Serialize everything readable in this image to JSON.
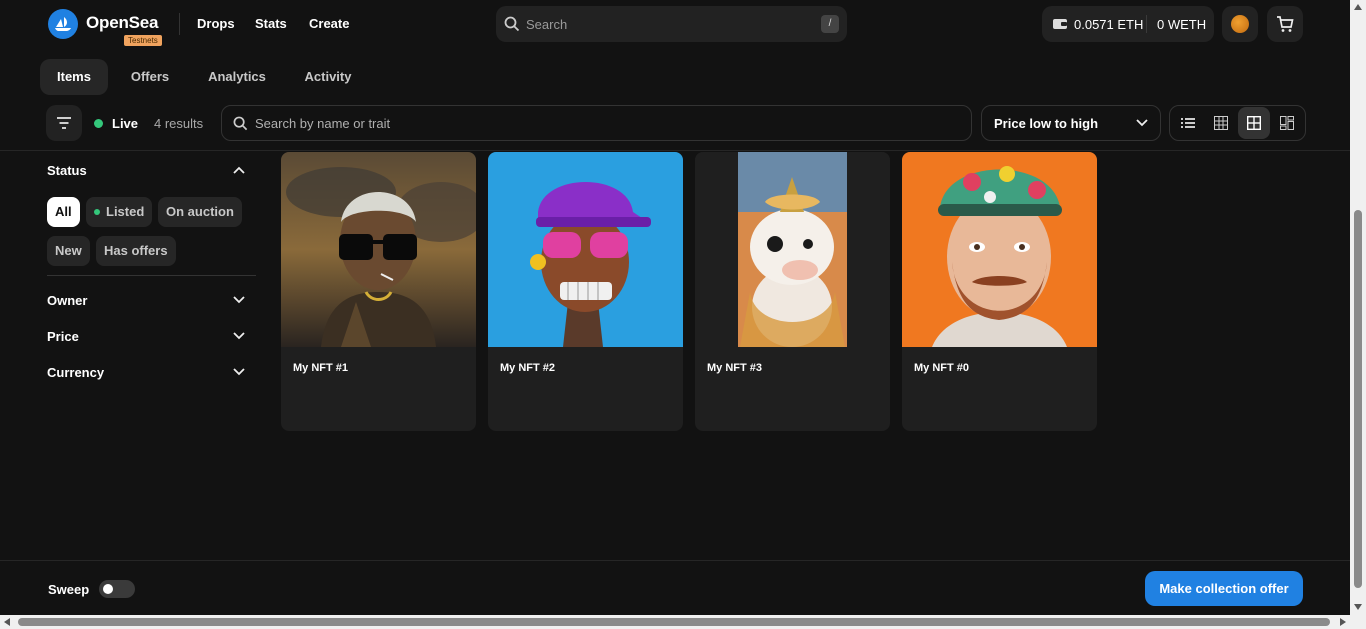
{
  "header": {
    "brand": "OpenSea",
    "badge": "Testnets",
    "nav": [
      "Drops",
      "Stats",
      "Create"
    ],
    "search_placeholder": "Search",
    "search_shortcut": "/",
    "wallet_eth": "0.0571 ETH",
    "wallet_weth": "0 WETH"
  },
  "tabs": [
    "Items",
    "Offers",
    "Analytics",
    "Activity"
  ],
  "toolbar": {
    "live_label": "Live",
    "results": "4 results",
    "search_placeholder": "Search by name or trait",
    "sort_value": "Price low to high"
  },
  "sidebar": {
    "status_title": "Status",
    "status_chips": [
      "All",
      "Listed",
      "On auction",
      "New",
      "Has offers"
    ],
    "sections": [
      "Owner",
      "Price",
      "Currency"
    ]
  },
  "items": [
    {
      "name": "My NFT #1"
    },
    {
      "name": "My NFT #2"
    },
    {
      "name": "My NFT #3"
    },
    {
      "name": "My NFT #0"
    }
  ],
  "footer": {
    "sweep_label": "Sweep",
    "offer_button": "Make collection offer"
  },
  "colors": {
    "accent": "#2081e2",
    "background": "#121212",
    "live": "#34c77b"
  }
}
